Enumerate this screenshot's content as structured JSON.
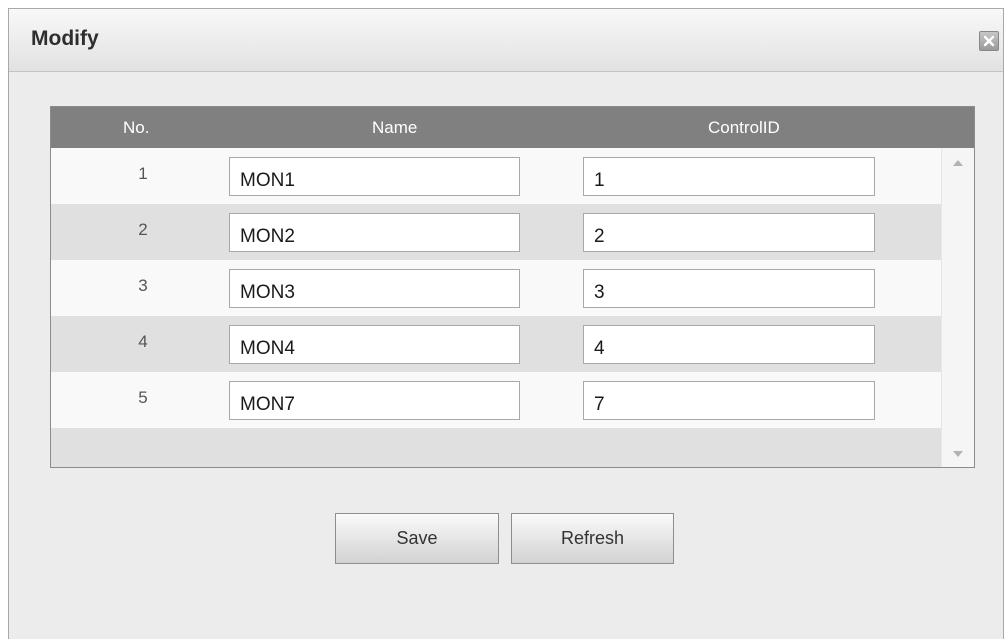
{
  "dialog": {
    "title": "Modify",
    "close_icon": "close-icon"
  },
  "table": {
    "columns": [
      "No.",
      "Name",
      "ControlID"
    ],
    "rows": [
      {
        "no": "1",
        "name": "MON1",
        "control_id": "1"
      },
      {
        "no": "2",
        "name": "MON2",
        "control_id": "2"
      },
      {
        "no": "3",
        "name": "MON3",
        "control_id": "3"
      },
      {
        "no": "4",
        "name": "MON4",
        "control_id": "4"
      },
      {
        "no": "5",
        "name": "MON7",
        "control_id": "7"
      }
    ],
    "scrollbar_icons": [
      "scroll-up-arrow-icon",
      "scroll-down-arrow-icon"
    ]
  },
  "buttons": {
    "save_label": "Save",
    "refresh_label": "Refresh"
  },
  "colors": {
    "header_bg": "#808080",
    "row_light": "#f9f9f9",
    "row_dark": "#e0e0e0",
    "dialog_bg": "#ececec"
  }
}
